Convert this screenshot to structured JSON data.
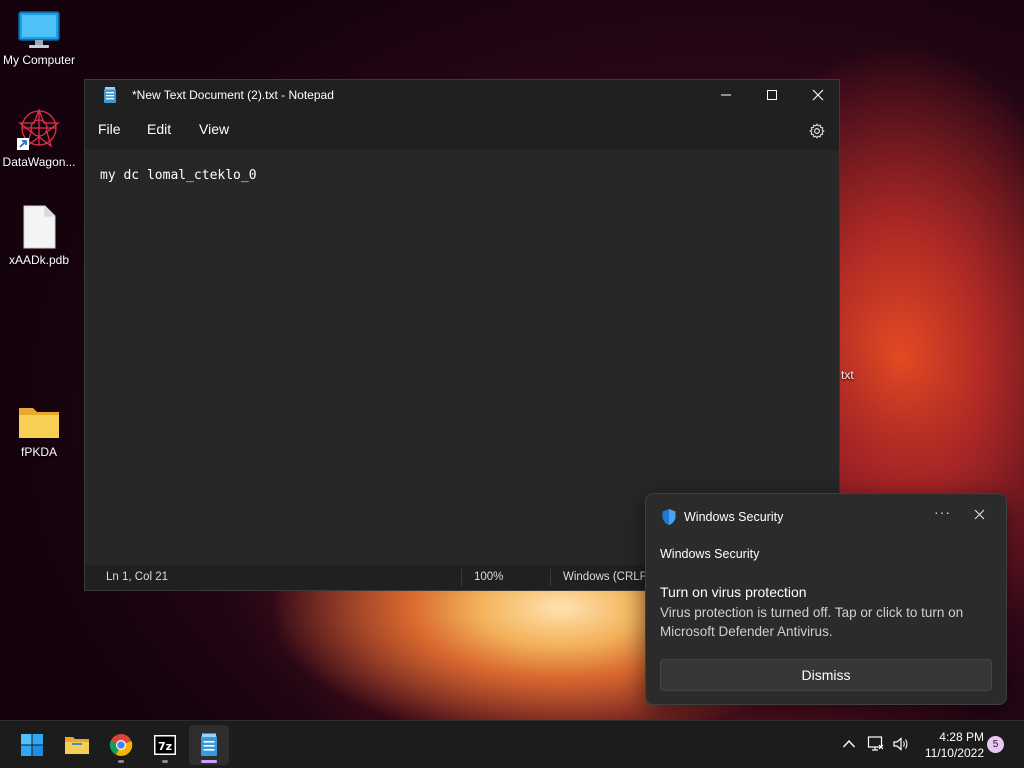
{
  "desktop": {
    "icons": [
      {
        "label": "My Computer"
      },
      {
        "label": "DataWagon..."
      },
      {
        "label": "xAADk.pdb"
      },
      {
        "label": "fPKDA"
      }
    ],
    "hidden_label_fragment": "txt"
  },
  "notepad": {
    "title": "*New Text Document (2).txt - Notepad",
    "menu": {
      "file": "File",
      "edit": "Edit",
      "view": "View"
    },
    "content": "my dc lomal_cteklo_0",
    "status": {
      "position": "Ln 1, Col 21",
      "zoom": "100%",
      "line_ending": "Windows (CRLF)"
    }
  },
  "toast": {
    "app_name": "Windows Security",
    "more": "···",
    "sender": "Windows Security",
    "heading": "Turn on virus protection",
    "body": "Virus protection is turned off. Tap or click to turn on Microsoft Defender Antivirus.",
    "dismiss_label": "Dismiss"
  },
  "taskbar": {
    "time": "4:28 PM",
    "date": "11/10/2022",
    "notification_count": "5"
  },
  "colors": {
    "accent_blue": "#0a78d4",
    "folder_yellow": "#f5c74a",
    "notepad_bg": "#272727",
    "badge": "#e9c7f5"
  }
}
